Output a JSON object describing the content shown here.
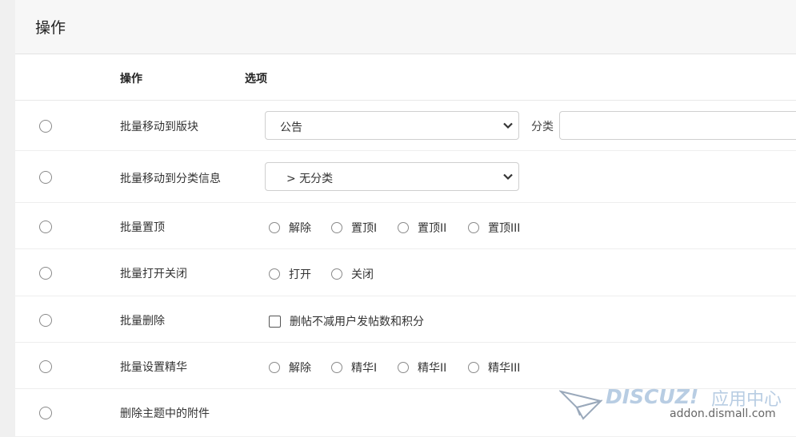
{
  "panel": {
    "title": "操作"
  },
  "columns": {
    "operation": "操作",
    "options": "选项"
  },
  "rows": [
    {
      "label": "批量移动到版块",
      "select_value": "公告",
      "category_label": "分类",
      "category_value": ""
    },
    {
      "label": "批量移动到分类信息",
      "select_value": "> 无分类"
    },
    {
      "label": "批量置顶",
      "options": [
        "解除",
        "置顶I",
        "置顶II",
        "置顶III"
      ]
    },
    {
      "label": "批量打开关闭",
      "options": [
        "打开",
        "关闭"
      ]
    },
    {
      "label": "批量删除",
      "checkbox_label": "删帖不减用户发帖数和积分"
    },
    {
      "label": "批量设置精华",
      "options": [
        "解除",
        "精华I",
        "精华II",
        "精华III"
      ]
    },
    {
      "label": "删除主题中的附件"
    }
  ],
  "watermark": {
    "logo": "DISCUZ!",
    "title": "应用中心",
    "url": "addon.dismall.com"
  }
}
